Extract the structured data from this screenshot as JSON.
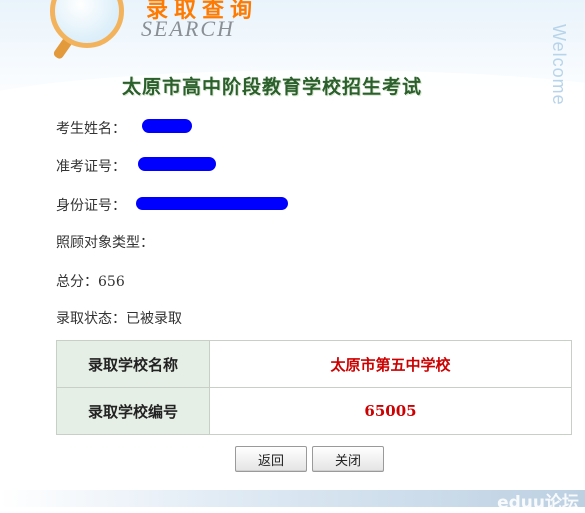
{
  "header": {
    "title_cn": "录取查询",
    "title_en": "SEARCH",
    "side_text": "Welcome",
    "exam_name": "太原市高中阶段教育学校招生考试"
  },
  "student": {
    "name_label": "考生姓名：",
    "ticket_label": "准考证号：",
    "id_label": "身份证号：",
    "care_label": "照顾对象类型：",
    "care_value": "",
    "score_label": "总分：",
    "score_value": "656",
    "status_label": "录取状态：",
    "status_value": "已被录取"
  },
  "result_table": {
    "rows": [
      {
        "label": "录取学校名称",
        "value": "太原市第五中学校"
      },
      {
        "label": "录取学校编号",
        "value": "65005"
      }
    ]
  },
  "buttons": {
    "back": "返回",
    "close": "关闭"
  },
  "footer": {
    "watermark": "eduu论坛"
  },
  "colors": {
    "redaction": "#0000ff",
    "value_red": "#cc0000",
    "table_header_bg": "#e6efe6"
  }
}
